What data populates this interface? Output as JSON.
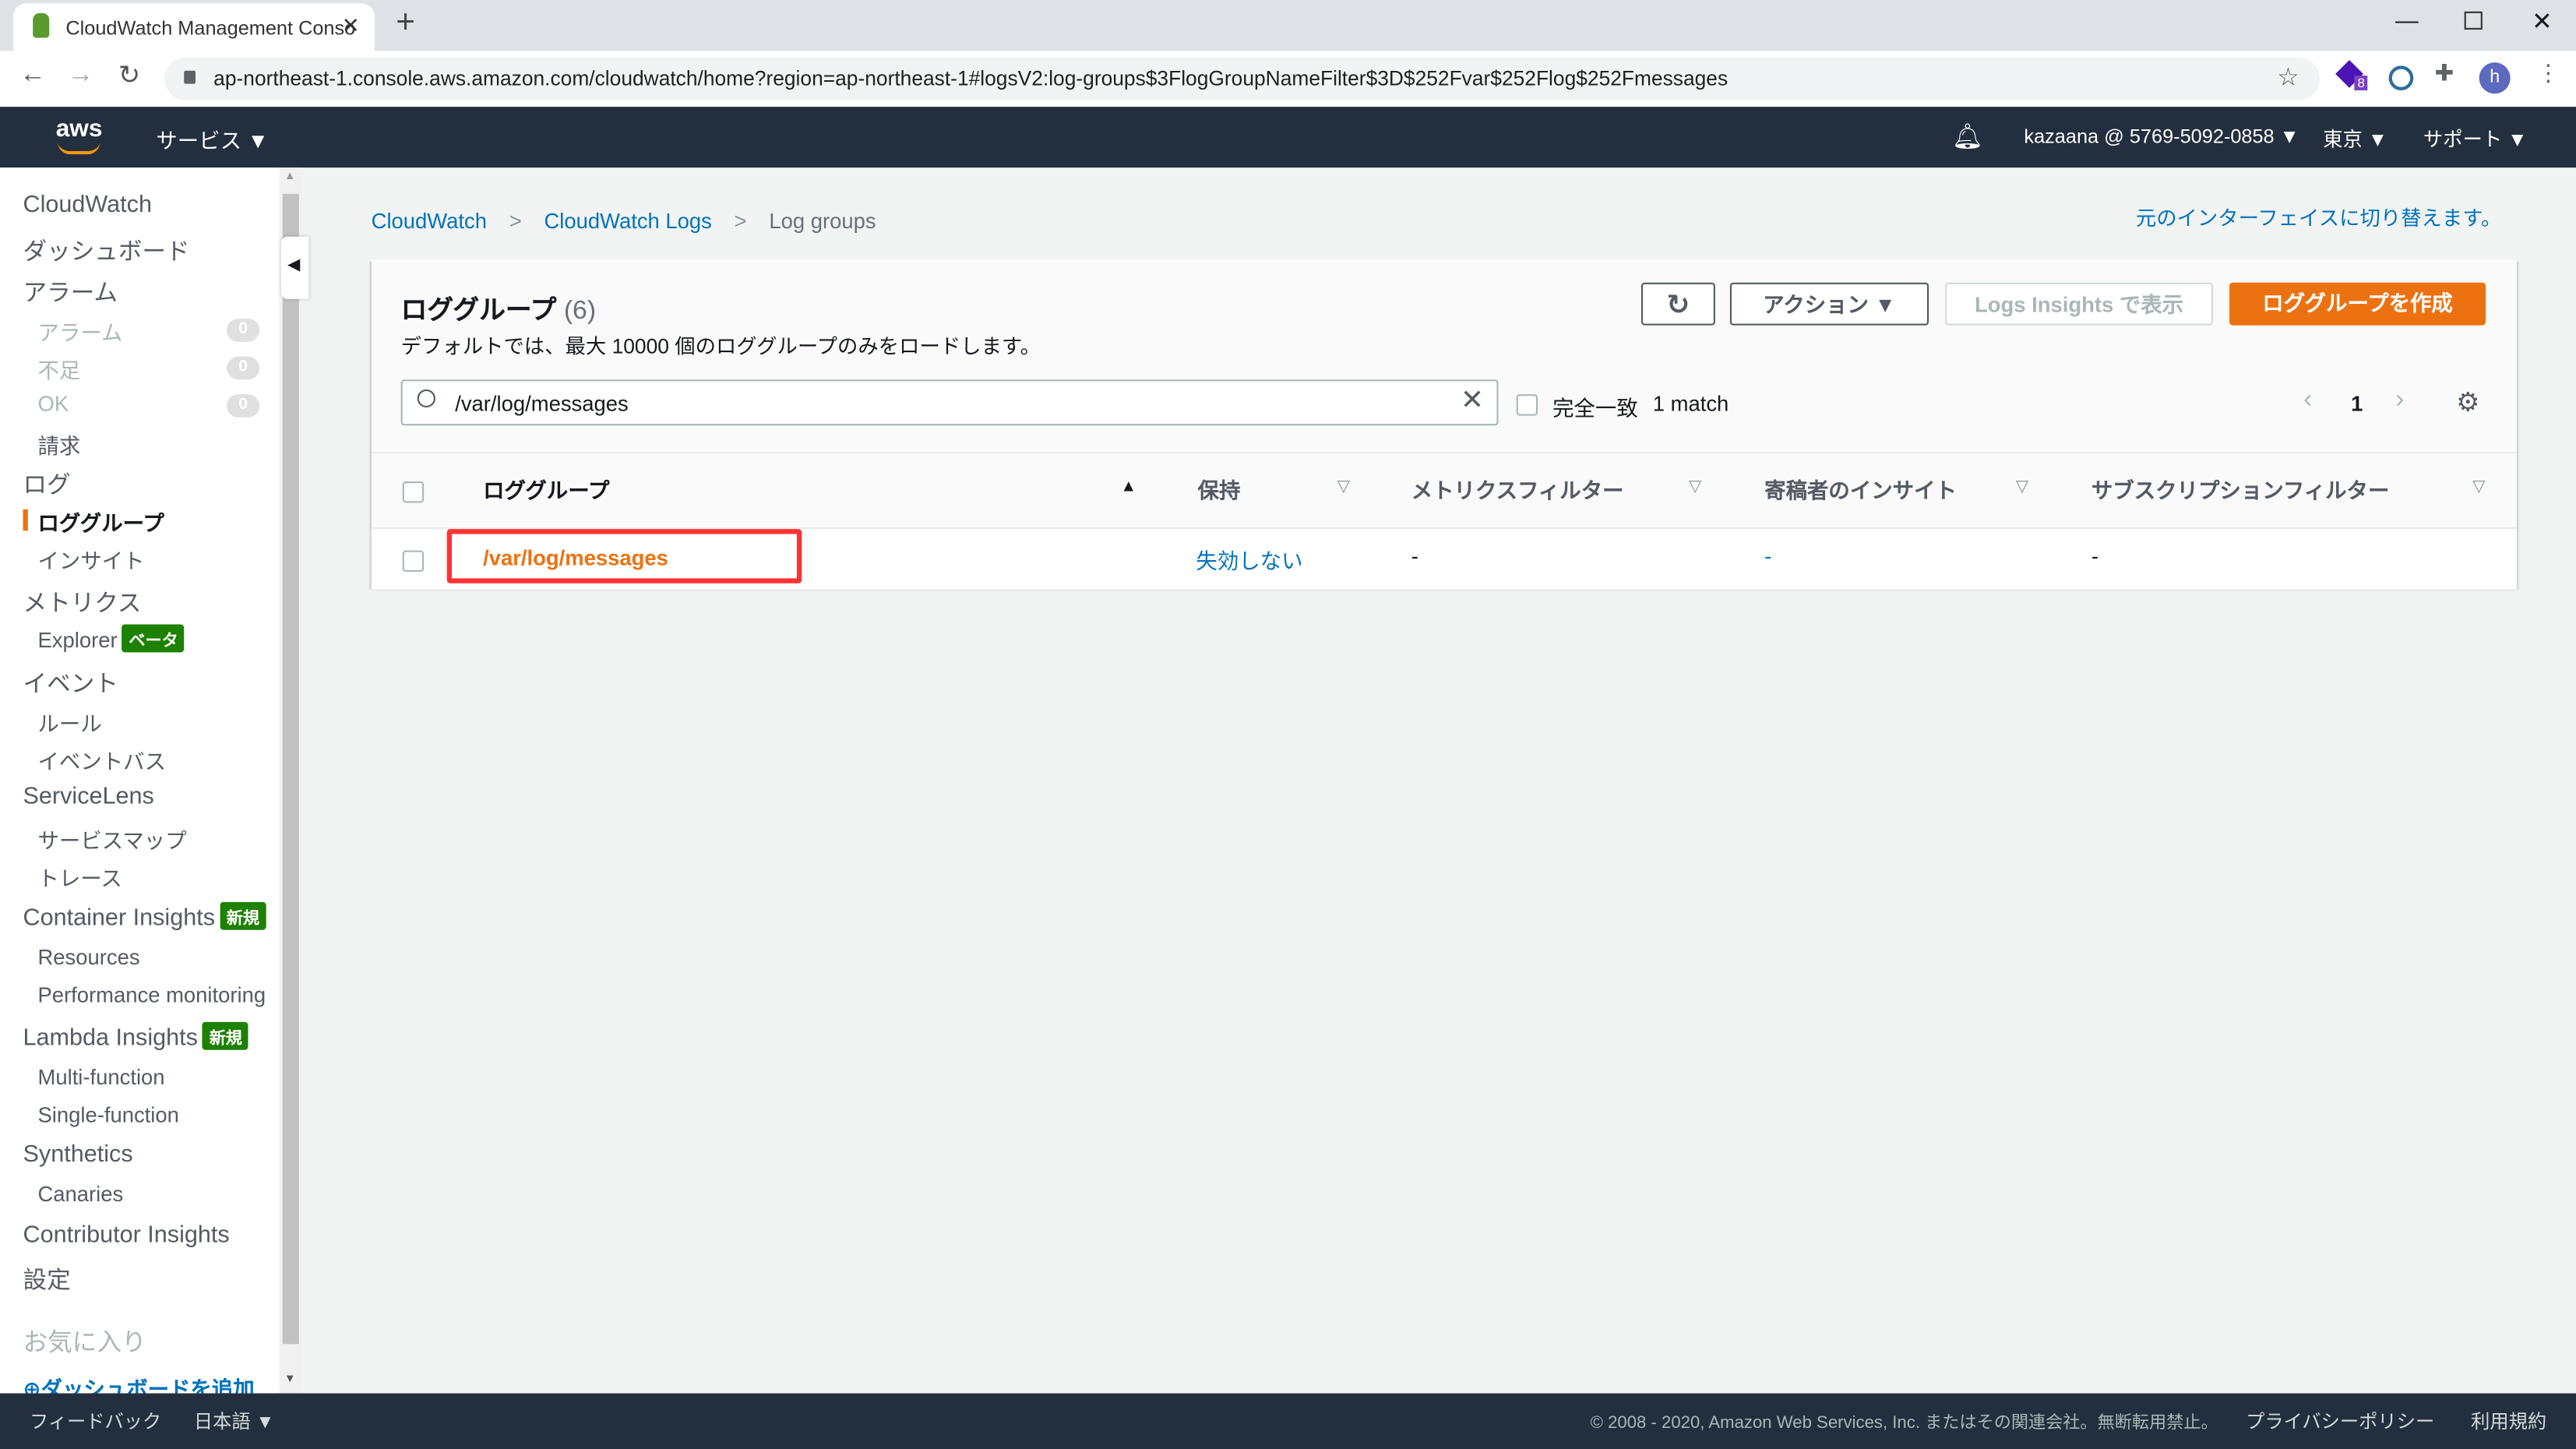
{
  "browser": {
    "tab_title": "CloudWatch Management Conso",
    "url": "ap-northeast-1.console.aws.amazon.com/cloudwatch/home?region=ap-northeast-1#logsV2:log-groups$3FlogGroupNameFilter$3D$252Fvar$252Flog$252Fmessages",
    "extension_badge": "8",
    "profile_initial": "h"
  },
  "awsnav": {
    "logo": "aws",
    "services": "サービス ▼",
    "account": "kazaana @ 5769-5092-0858 ▼",
    "region": "東京 ▼",
    "support": "サポート ▼"
  },
  "sidebar": {
    "items": [
      {
        "label": "CloudWatch"
      },
      {
        "label": "ダッシュボード"
      },
      {
        "label": "アラーム"
      },
      {
        "label": "アラーム",
        "count": "0"
      },
      {
        "label": "不足",
        "count": "0"
      },
      {
        "label": "OK",
        "count": "0"
      },
      {
        "label": "請求"
      },
      {
        "label": "ログ"
      },
      {
        "label": "ロググループ"
      },
      {
        "label": "インサイト"
      },
      {
        "label": "メトリクス"
      },
      {
        "label": "Explorer",
        "badge": "ベータ"
      },
      {
        "label": "イベント"
      },
      {
        "label": "ルール"
      },
      {
        "label": "イベントバス"
      },
      {
        "label": "ServiceLens"
      },
      {
        "label": "サービスマップ"
      },
      {
        "label": "トレース"
      },
      {
        "label": "Container Insights",
        "badge": "新規"
      },
      {
        "label": "Resources"
      },
      {
        "label": "Performance monitoring"
      },
      {
        "label": "Lambda Insights",
        "badge": "新規"
      },
      {
        "label": "Multi-function"
      },
      {
        "label": "Single-function"
      },
      {
        "label": "Synthetics"
      },
      {
        "label": "Canaries"
      },
      {
        "label": "Contributor Insights"
      },
      {
        "label": "設定"
      },
      {
        "label": "お気に入り"
      },
      {
        "label": "ダッシュボードを追加"
      }
    ]
  },
  "breadcrumb": [
    "CloudWatch",
    "CloudWatch Logs",
    "Log groups"
  ],
  "switch_link": "元のインターフェイスに切り替えます。",
  "panel": {
    "title": "ロググループ",
    "count": "(6)",
    "description": "デフォルトでは、最大 10000 個のロググループのみをロードします。",
    "actions": "アクション ▼",
    "logs_insights": "Logs Insights で表示",
    "create": "ロググループを作成",
    "search_value": "/var/log/messages",
    "exact_match": "完全一致",
    "match_count": "1 match",
    "page": "1",
    "columns": [
      "ロググループ",
      "保持",
      "メトリクスフィルター",
      "寄稿者のインサイト",
      "サブスクリプションフィルター"
    ],
    "rows": [
      {
        "name": "/var/log/messages",
        "retention": "失効しない",
        "metric_filters": "-",
        "contributor": "-",
        "subscription": "-"
      }
    ]
  },
  "footer": {
    "feedback": "フィードバック",
    "language": "日本語 ▼",
    "copyright": "© 2008 - 2020, Amazon Web Services, Inc. またはその関連会社。無断転用禁止。",
    "privacy": "プライバシーポリシー",
    "terms": "利用規約"
  },
  "colors": {
    "accent": "#ec7211",
    "link": "#0073bb",
    "nav": "#232f3e",
    "highlight": "#ff3333",
    "badge": "#1d8102"
  }
}
